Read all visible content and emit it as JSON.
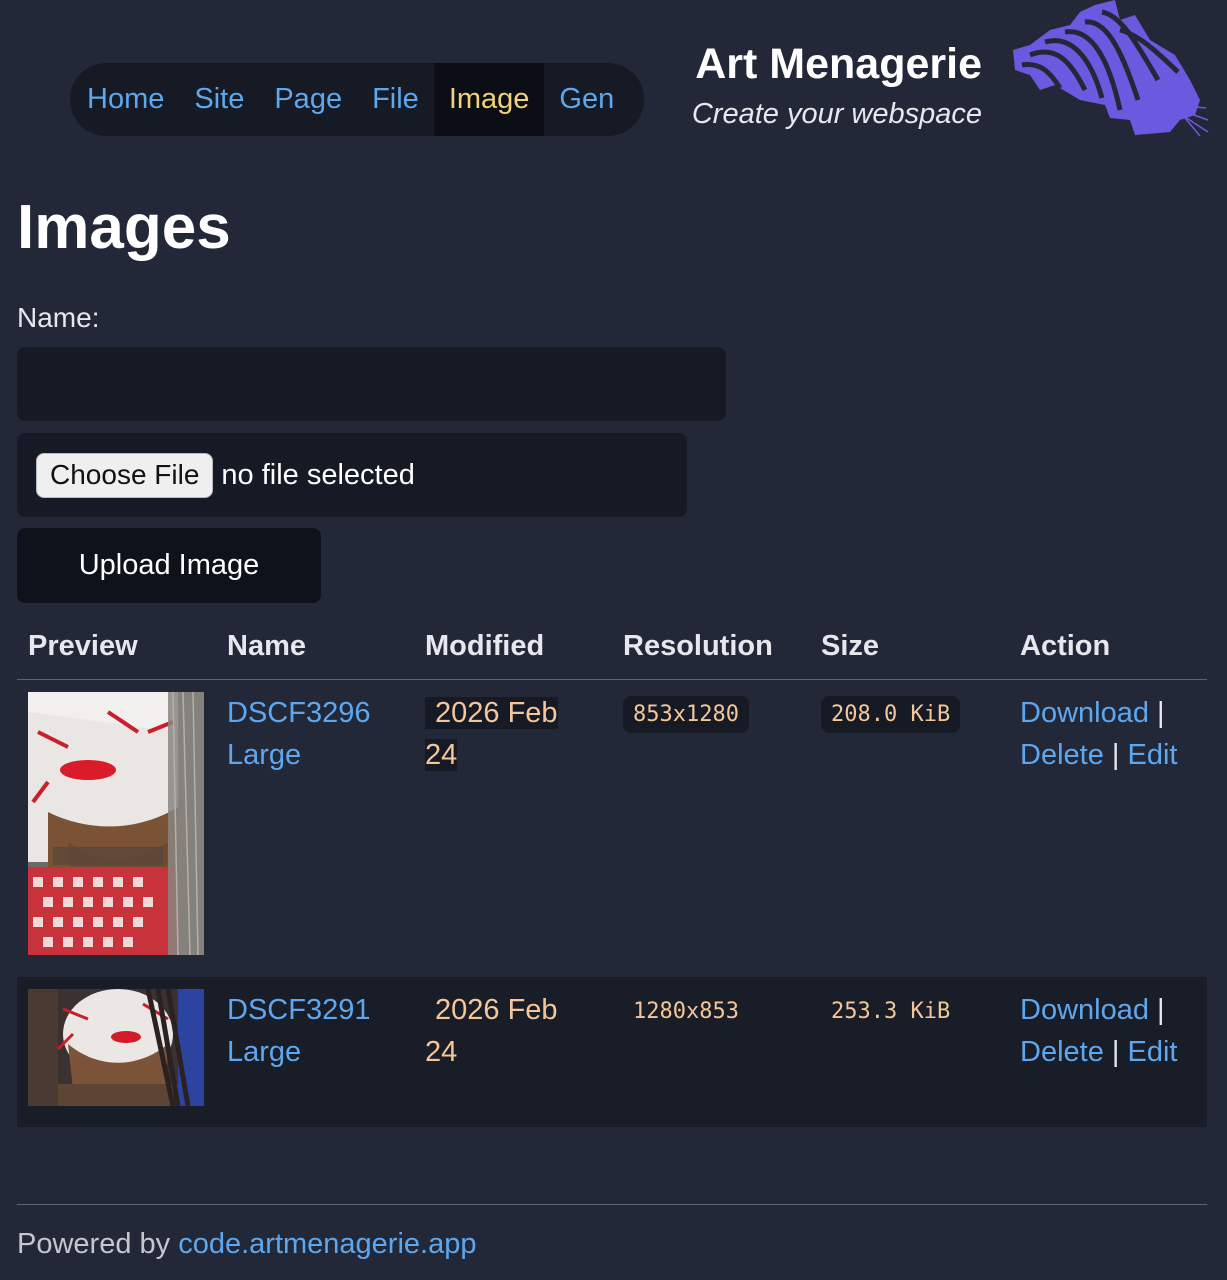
{
  "nav": {
    "items": [
      {
        "label": "Home"
      },
      {
        "label": "Site"
      },
      {
        "label": "Page"
      },
      {
        "label": "File"
      },
      {
        "label": "Image",
        "active": true
      },
      {
        "label": "Gen"
      }
    ]
  },
  "brand": {
    "title": "Art Menagerie",
    "tagline": "Create your webspace",
    "logo_icon": "zebra-head-logo",
    "logo_color": "#6a5ae0"
  },
  "page": {
    "title": "Images"
  },
  "form": {
    "name_label": "Name:",
    "name_value": "",
    "choose_file_label": "Choose File",
    "file_status": "no file selected",
    "upload_label": "Upload Image"
  },
  "table": {
    "headers": [
      "Preview",
      "Name",
      "Modified",
      "Resolution",
      "Size",
      "Action"
    ],
    "rows": [
      {
        "name_line1": "DSCF3296",
        "name_line2": "Large",
        "modified_line1": "2026 Feb",
        "modified_line2": "24",
        "resolution": "853x1280",
        "size": "208.0 KiB",
        "download": "Download",
        "delete": "Delete",
        "edit": "Edit",
        "sep": "|"
      },
      {
        "name_line1": "DSCF3291",
        "name_line2": "Large",
        "modified_line1": "2026 Feb",
        "modified_line2": "24",
        "resolution": "1280x853",
        "size": "253.3 KiB",
        "download": "Download",
        "delete": "Delete",
        "edit": "Edit",
        "sep": "|"
      }
    ]
  },
  "footer": {
    "prefix": "Powered by",
    "link": "code.artmenagerie.app"
  },
  "colors": {
    "background": "#232838",
    "link": "#5ea7ee",
    "active_nav": "#f1d27a",
    "code_text": "#f4c69a"
  }
}
